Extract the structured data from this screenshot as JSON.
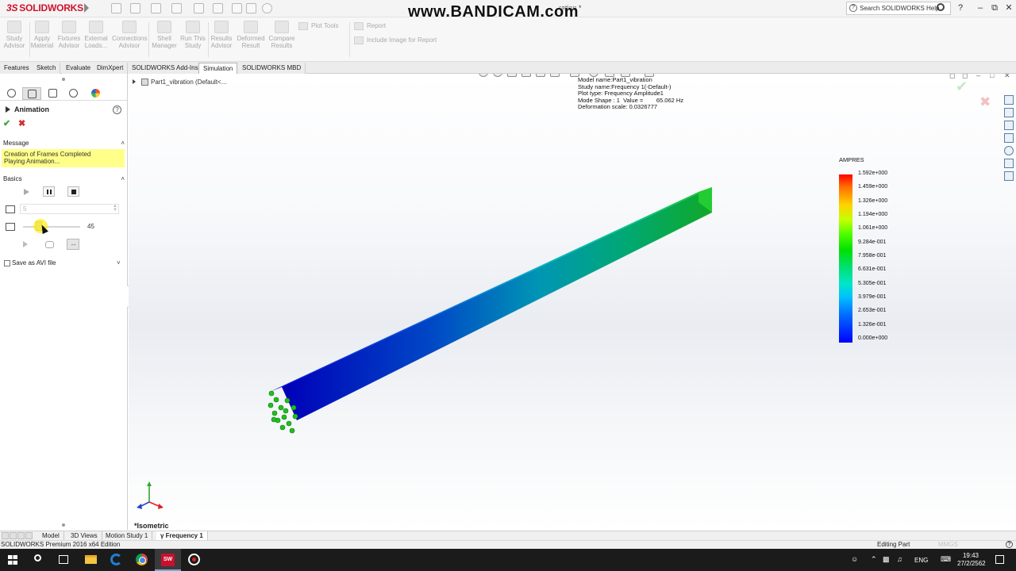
{
  "titlebar": {
    "logo": "SOLIDWORKS",
    "watermark": "www.BANDICAM.com",
    "doc_title": "ration *",
    "search_placeholder": "Search SOLIDWORKS Help",
    "help_label": "?",
    "minimize": "–",
    "restore": "⧉",
    "close": "✕"
  },
  "commandmanager": {
    "buttons": [
      {
        "label": "Study\nAdvisor"
      },
      {
        "label": "Apply\nMaterial"
      },
      {
        "label": "Fixtures\nAdvisor"
      },
      {
        "label": "External\nLoads..."
      },
      {
        "label": "Connections\nAdvisor"
      },
      {
        "label": "Shell\nManager"
      },
      {
        "label": "Run This\nStudy"
      },
      {
        "label": "Results\nAdvisor"
      },
      {
        "label": "Deformed\nResult"
      },
      {
        "label": "Compare\nResults"
      }
    ],
    "plot_tools": "Plot Tools",
    "report": "Report",
    "include_image": "Include Image for Report"
  },
  "tabs": [
    "Features",
    "Sketch",
    "Evaluate",
    "DimXpert",
    "SOLIDWORKS Add-Ins",
    "Simulation",
    "SOLIDWORKS MBD"
  ],
  "active_tab": "Simulation",
  "property_manager": {
    "title": "Animation",
    "help": "?",
    "ok": "✔",
    "cancel": "✖",
    "message_header": "Message",
    "message_lines": [
      "Creation of Frames Completed",
      "Playing Animation..."
    ],
    "basics_header": "Basics",
    "frames_value": "5",
    "speed_value": "45",
    "speed_fraction": 0.25,
    "save_avi_label": "Save as AVI file",
    "collapse": "˄",
    "expand": "˅"
  },
  "graphics": {
    "tree_item": "Part1_vibration  (Default<...",
    "plot_info": [
      "Model name:Part1_vibration",
      "Study name:Frequency 1(-Default-)",
      "Plot type: Frequency Amplitude1",
      "Mode Shape : 1  Value =        65.062 Hz",
      "Deformation scale: 0.0326777"
    ],
    "legend_title": "AMPRES",
    "legend_labels": [
      "1.592e+000",
      "1.459e+000",
      "1.326e+000",
      "1.194e+000",
      "1.061e+000",
      "9.284e-001",
      "7.958e-001",
      "6.631e-001",
      "5.305e-001",
      "3.979e-001",
      "2.653e-001",
      "1.326e-001",
      "0.000e+000"
    ],
    "view_name": "*Isometric",
    "accept": "✔",
    "reject": "✖"
  },
  "bottom_tabs": [
    "Model",
    "3D Views",
    "Motion Study 1",
    "Frequency 1"
  ],
  "active_bottom_tab": "Frequency 1",
  "statusbar": {
    "edition": "SOLIDWORKS Premium 2016 x64 Edition",
    "mode": "Editing Part",
    "units": "MMGS",
    "help": "?"
  },
  "taskbar": {
    "language": "ENG",
    "time": "19:43",
    "date": "27/2/2562",
    "sw_icon": "SW"
  },
  "colors": {
    "solidworks_red": "#d0102a",
    "message_yellow": "#ffff8a",
    "accept_green": "#3aa33a",
    "reject_red": "#d0302a"
  }
}
